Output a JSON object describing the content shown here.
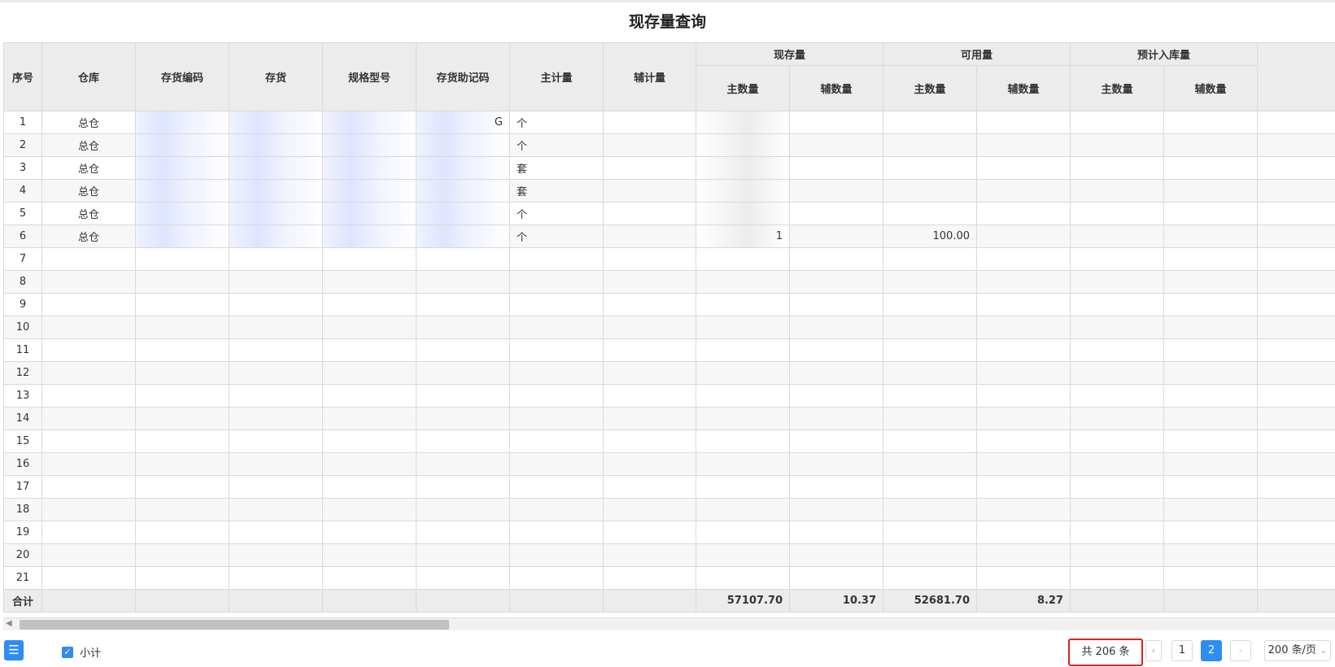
{
  "title": "现存量查询",
  "headers": {
    "idx": "序号",
    "warehouse": "仓库",
    "code": "存货编码",
    "item": "存货",
    "spec": "规格型号",
    "mnemonic": "存货助记码",
    "main_unit": "主计量",
    "aux_unit": "辅计量",
    "onhand": "现存量",
    "available": "可用量",
    "incoming": "预计入库量",
    "main_qty": "主数量",
    "aux_qty": "辅数量"
  },
  "rows": [
    {
      "idx": "1",
      "warehouse": "总仓",
      "mnemonic": "G",
      "main_unit": "个",
      "onhand_main": "",
      "available_main": ""
    },
    {
      "idx": "2",
      "warehouse": "总仓",
      "mnemonic": "",
      "main_unit": "个",
      "onhand_main": "",
      "available_main": ""
    },
    {
      "idx": "3",
      "warehouse": "总仓",
      "mnemonic": "",
      "main_unit": "套",
      "onhand_main": "",
      "available_main": ""
    },
    {
      "idx": "4",
      "warehouse": "总仓",
      "mnemonic": "",
      "main_unit": "套",
      "onhand_main": "",
      "available_main": ""
    },
    {
      "idx": "5",
      "warehouse": "总仓",
      "mnemonic": "",
      "main_unit": "个",
      "onhand_main": "",
      "available_main": ""
    },
    {
      "idx": "6",
      "warehouse": "总仓",
      "mnemonic": "",
      "main_unit": "个",
      "onhand_main": "1",
      "available_main": "100.00"
    },
    {
      "idx": "7"
    },
    {
      "idx": "8"
    },
    {
      "idx": "9"
    },
    {
      "idx": "10"
    },
    {
      "idx": "11"
    },
    {
      "idx": "12"
    },
    {
      "idx": "13"
    },
    {
      "idx": "14"
    },
    {
      "idx": "15"
    },
    {
      "idx": "16"
    },
    {
      "idx": "17"
    },
    {
      "idx": "18"
    },
    {
      "idx": "19"
    },
    {
      "idx": "20"
    },
    {
      "idx": "21"
    }
  ],
  "totals": {
    "label": "合计",
    "onhand_main": "57107.70",
    "onhand_aux": "10.37",
    "available_main": "52681.70",
    "available_aux": "8.27"
  },
  "footer": {
    "menu_icon": "☰",
    "subtotal_label": "小计",
    "subtotal_checked": true,
    "total_count": "共 206 条",
    "pages": [
      "1",
      "2"
    ],
    "current_page": "2",
    "page_size": "200 条/页",
    "prev_icon": "‹",
    "next_icon": "›",
    "size_icon": "⌄"
  },
  "colors": {
    "accent": "#2e8df3",
    "link": "#3b7dd8",
    "highlight_border": "#e02020"
  }
}
